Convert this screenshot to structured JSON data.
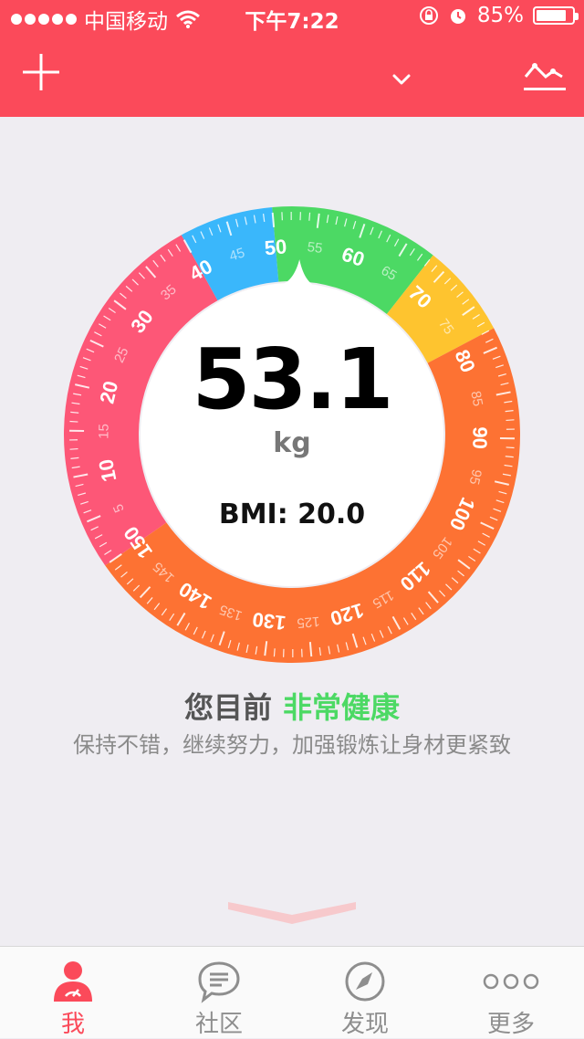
{
  "status_bar": {
    "carrier": "中国移动",
    "time": "下午7:22",
    "battery_text": "85%",
    "battery_level": 0.85
  },
  "header": {
    "add_icon": "plus-icon",
    "dropdown_icon": "chevron-down-icon",
    "trend_icon": "line-chart-icon"
  },
  "dial": {
    "weight": "53.1",
    "unit": "kg",
    "bmi": "BMI: 20.0",
    "scale_min": 0,
    "scale_max": 150,
    "current_weight": 53.1,
    "bands": [
      {
        "from": 0,
        "to": 40,
        "color": "#fd5777"
      },
      {
        "from": 40,
        "to": 50,
        "color": "#3ab7fb"
      },
      {
        "from": 50,
        "to": 68,
        "color": "#4cd964"
      },
      {
        "from": 68,
        "to": 78,
        "color": "#fec42f"
      },
      {
        "from": 78,
        "to": 150,
        "color": "#fd7233"
      }
    ],
    "major_labels": [
      "10",
      "20",
      "30",
      "40",
      "50",
      "60",
      "70",
      "80",
      "90",
      "100",
      "110",
      "120",
      "130",
      "140",
      "150"
    ],
    "minor_labels": [
      "5",
      "15",
      "25",
      "35",
      "45",
      "55",
      "65",
      "75",
      "85",
      "95",
      "105",
      "115",
      "125",
      "135",
      "145"
    ]
  },
  "result": {
    "prefix": "您目前",
    "status": "非常健康",
    "status_color": "#4cd964",
    "advice": "保持不错，继续努力，加强锻炼让身材更紧致"
  },
  "tabs": [
    {
      "label": "我",
      "icon": "profile-icon",
      "active": true
    },
    {
      "label": "社区",
      "icon": "chat-bubble-icon",
      "active": false
    },
    {
      "label": "发现",
      "icon": "compass-icon",
      "active": false
    },
    {
      "label": "更多",
      "icon": "more-dots-icon",
      "active": false
    }
  ],
  "colors": {
    "accent": "#fb4a5a",
    "background": "#efedf2"
  }
}
